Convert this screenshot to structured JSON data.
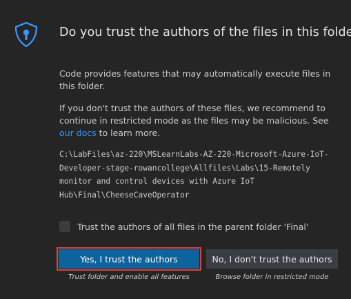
{
  "dialog": {
    "title": "Do you trust the authors of the files in this folder?",
    "paragraph1": "Code provides features that may automatically execute files in this folder.",
    "paragraph2_text": "If you don't trust the authors of these files, we recommend to continue in restricted mode as the files may be malicious. See ",
    "paragraph2_link": "our docs",
    "paragraph2_suffix": " to learn more.",
    "folder_path": "C:\\LabFiles\\az-220\\MSLearnLabs-AZ-220-Microsoft-Azure-IoT-\nDeveloper-stage-rowancollege\\Allfiles\\Labs\\15-Remotely\nmonitor and control devices with Azure IoT\nHub\\Final\\CheeseCaveOperator",
    "checkbox_label": "Trust the authors of all files in the parent folder 'Final'",
    "primary_button": "Yes, I trust the authors",
    "primary_caption": "Trust folder and enable all features",
    "secondary_button": "No, I don't trust the authors",
    "secondary_caption": "Browse folder in restricted mode"
  },
  "icons": {
    "header": "shield-lock-icon"
  },
  "colors": {
    "background": "#252526",
    "shield": "#3794ff",
    "primary_button": "#0e639c",
    "secondary_button": "#3a3d41",
    "link": "#3794ff",
    "highlight": "#e0403a"
  }
}
